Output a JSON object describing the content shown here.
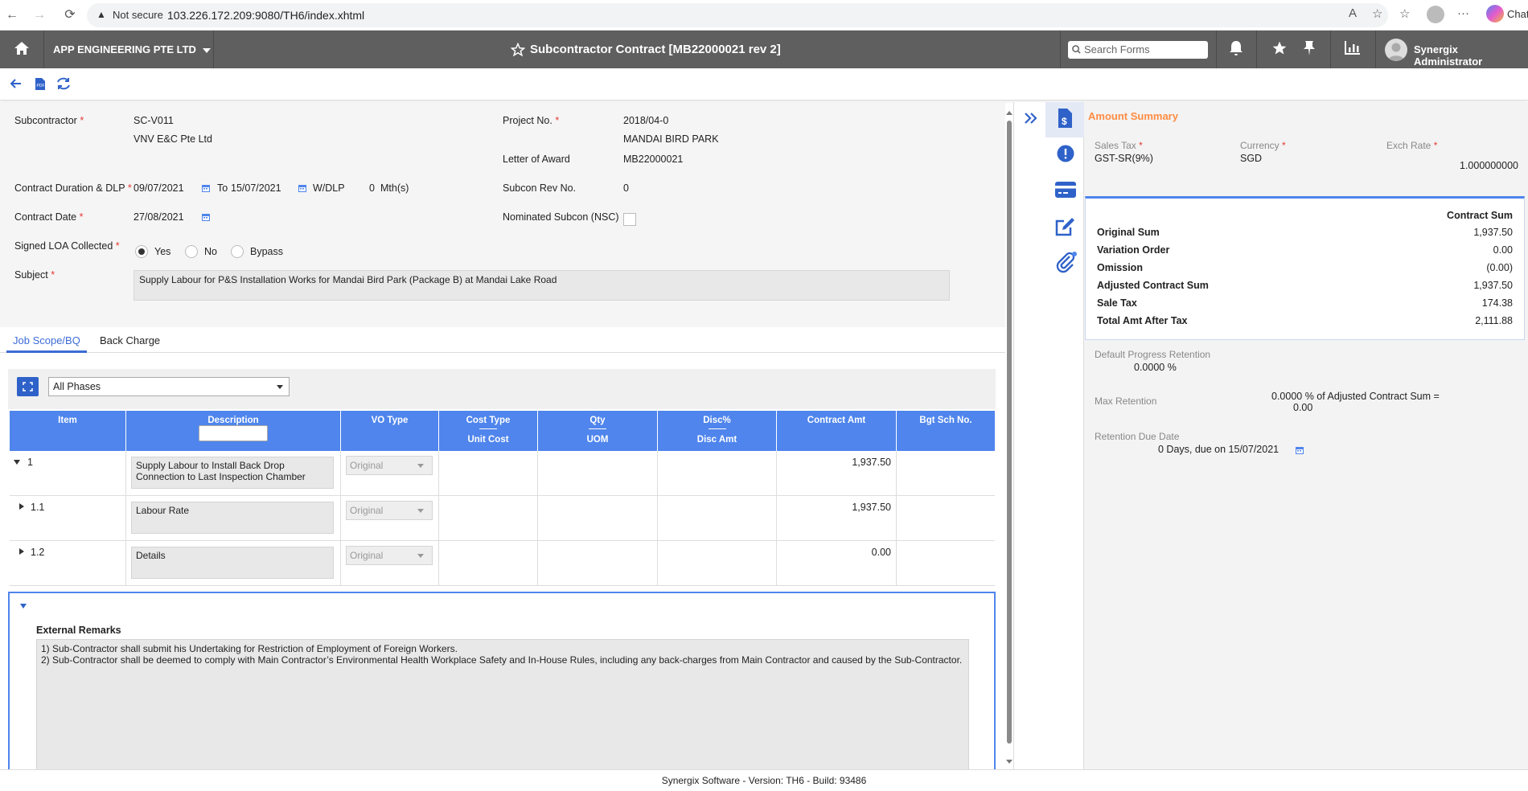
{
  "browser": {
    "security": "Not secure",
    "url": "103.226.172.209:9080/TH6/index.xhtml"
  },
  "app": {
    "company": "APP ENGINEERING PTE LTD",
    "title": "Subcontractor Contract [MB22000021 rev 2]",
    "search_placeholder": "Search Forms",
    "user": "Synergix Administrator"
  },
  "form": {
    "subcontractor_label": "Subcontractor",
    "subcontractor_code": "SC-V011",
    "subcontractor_name": "VNV E&C Pte Ltd",
    "project_label": "Project No.",
    "project_no": "2018/04-0",
    "project_name": "MANDAI BIRD PARK",
    "loa_label": "Letter of Award",
    "loa_value": "MB22000021",
    "duration_label": "Contract Duration & DLP",
    "duration_from": "09/07/2021",
    "duration_to_label": "To",
    "duration_to": "15/07/2021",
    "wdlp_label": "W/DLP",
    "dlp_value": "0",
    "dlp_unit": "Mth(s)",
    "subcon_rev_label": "Subcon Rev No.",
    "subcon_rev": "0",
    "contract_date_label": "Contract Date",
    "contract_date": "27/08/2021",
    "nsc_label": "Nominated Subcon (NSC)",
    "signed_loa_label": "Signed LOA Collected",
    "radio_yes": "Yes",
    "radio_no": "No",
    "radio_bypass": "Bypass",
    "subject_label": "Subject",
    "subject": "Supply Labour for P&S Installation Works for Mandai Bird Park (Package B) at Mandai Lake Road"
  },
  "tabs": [
    "Job Scope/BQ",
    "Back Charge"
  ],
  "grid": {
    "phase_filter": "All Phases",
    "headers": {
      "item": "Item",
      "description": "Description",
      "vo_type": "VO Type",
      "cost_type": "Cost Type",
      "unit_cost": "Unit Cost",
      "qty": "Qty",
      "uom": "UOM",
      "disc_pct": "Disc%",
      "disc_amt": "Disc Amt",
      "contract_amt": "Contract Amt",
      "bgt_sch": "Bgt Sch No."
    },
    "rows": [
      {
        "item": "1",
        "description": "Supply Labour to Install Back Drop Connection to Last Inspection Chamber",
        "vo_type": "Original",
        "contract_amt": "1,937.50"
      },
      {
        "item": "1.1",
        "description": "Labour Rate",
        "vo_type": "Original",
        "contract_amt": "1,937.50"
      },
      {
        "item": "1.2",
        "description": "Details",
        "vo_type": "Original",
        "contract_amt": "0.00"
      }
    ]
  },
  "remarks": {
    "title": "External Remarks",
    "line1": "1) Sub-Contractor shall submit his Undertaking for Restriction of Employment of Foreign Workers.",
    "line2": "2) Sub-Contractor shall be deemed to comply with Main Contractor’s Environmental Health Workplace Safety and In-House Rules, including any back-charges from Main Contractor and caused by the Sub-Contractor."
  },
  "amount_summary": {
    "title": "Amount Summary",
    "sales_tax_label": "Sales Tax",
    "sales_tax": "GST-SR(9%)",
    "currency_label": "Currency",
    "currency": "SGD",
    "exch_rate_label": "Exch Rate",
    "exch_rate": "1.000000000",
    "contract_sum_header": "Contract Sum",
    "lines": [
      {
        "label": "Original Sum",
        "value": "1,937.50"
      },
      {
        "label": "Variation Order",
        "value": "0.00"
      },
      {
        "label": "Omission",
        "value": "(0.00)"
      },
      {
        "label": "Adjusted Contract Sum",
        "value": "1,937.50"
      },
      {
        "label": "Sale Tax",
        "value": "174.38"
      },
      {
        "label": "Total Amt After Tax",
        "value": "2,111.88"
      }
    ],
    "default_retention_label": "Default Progress Retention",
    "default_retention": "0.0000 %",
    "max_retention_label": "Max Retention",
    "max_retention": "0.0000 % of Adjusted Contract Sum =",
    "max_retention_amt": "0.00",
    "due_date_label": "Retention Due Date",
    "due_date": "0 Days, due on 15/07/2021"
  },
  "footer": "Synergix Software - Version: TH6 - Build: 93486",
  "colors": {
    "header_bg": "#5f5f5f",
    "accent": "#4f85ec",
    "summary_title": "#ff8c42"
  }
}
